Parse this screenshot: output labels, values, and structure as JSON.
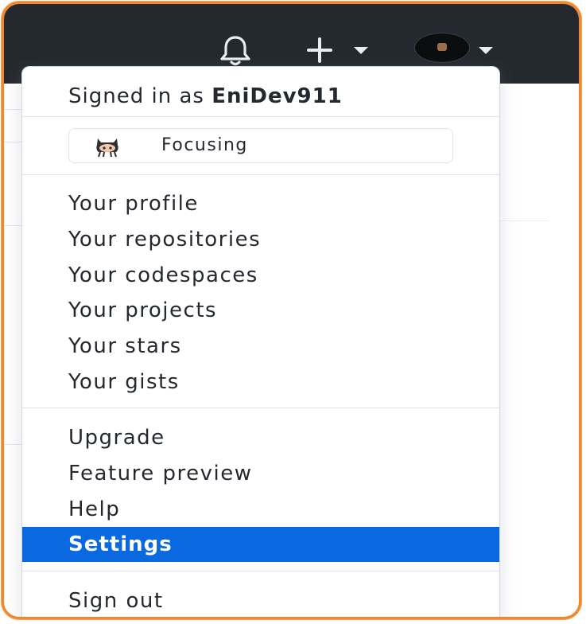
{
  "header": {
    "bell_icon": "bell-icon",
    "create_icon": "plus-icon",
    "dropdown_icon": "caret-down-icon",
    "avatar_icon": "user-avatar"
  },
  "menu": {
    "signed_in_prefix": "Signed in as",
    "username": "EniDev911",
    "status": {
      "emoji_icon": "octocat-icon",
      "label": "Focusing"
    },
    "profile_items": [
      "Your profile",
      "Your repositories",
      "Your codespaces",
      "Your projects",
      "Your stars",
      "Your gists"
    ],
    "secondary_items": [
      "Upgrade",
      "Feature preview",
      "Help",
      "Settings"
    ],
    "active_item": "Settings",
    "sign_out": "Sign out"
  },
  "colors": {
    "header_bg": "#24292f",
    "highlight": "#0a68e0",
    "frame_border": "#f0872c"
  }
}
